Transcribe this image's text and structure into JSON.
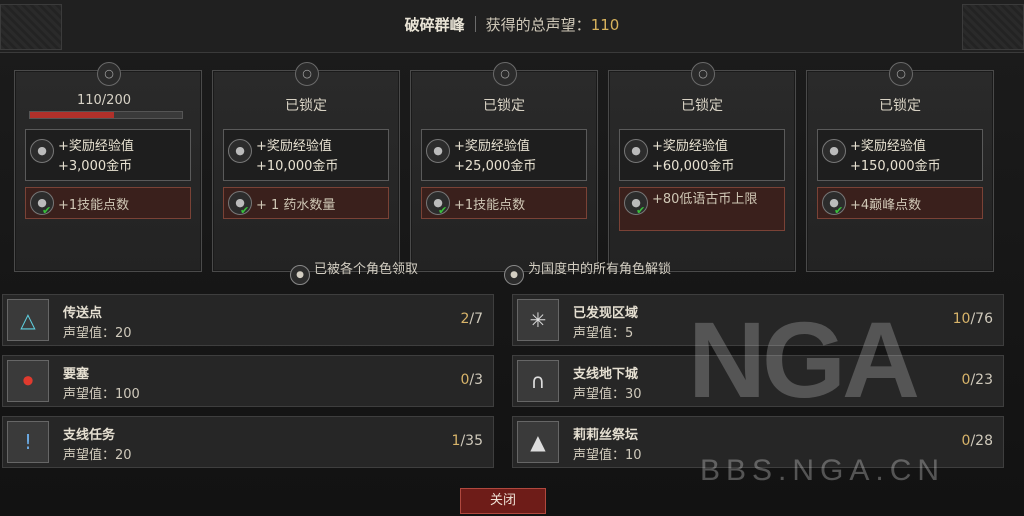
{
  "header": {
    "region_name": "破碎群峰",
    "renown_label": "获得的总声望：",
    "renown_total": "110"
  },
  "tiers": [
    {
      "status": "",
      "progress": "110/200",
      "progress_fraction": 0.55,
      "xp_label": "+奖励经验值",
      "gold_label": "+3,000金币",
      "bonus_label": "+1技能点数",
      "bonus_tall": false
    },
    {
      "status": "已锁定",
      "progress": "",
      "progress_fraction": null,
      "xp_label": "+奖励经验值",
      "gold_label": "+10,000金币",
      "bonus_label": "+ 1 药水数量",
      "bonus_tall": false
    },
    {
      "status": "已锁定",
      "progress": "",
      "progress_fraction": null,
      "xp_label": "+奖励经验值",
      "gold_label": "+25,000金币",
      "bonus_label": "+1技能点数",
      "bonus_tall": false
    },
    {
      "status": "已锁定",
      "progress": "",
      "progress_fraction": null,
      "xp_label": "+奖励经验值",
      "gold_label": "+60,000金币",
      "bonus_label": "+80低语古币上限",
      "bonus_tall": true
    },
    {
      "status": "已锁定",
      "progress": "",
      "progress_fraction": null,
      "xp_label": "+奖励经验值",
      "gold_label": "+150,000金币",
      "bonus_label": "+4巅峰点数",
      "bonus_tall": false
    }
  ],
  "legend": {
    "claimed_label": "已被各个角色领取",
    "realm_label": "为国度中的所有角色解锁"
  },
  "categories": [
    {
      "name": "传送点",
      "rep_label": "声望值：",
      "rep_value": "20",
      "current": "2",
      "total": "/7",
      "icon": "waypoint-icon"
    },
    {
      "name": "要塞",
      "rep_label": "声望值：",
      "rep_value": "100",
      "current": "0",
      "total": "/3",
      "icon": "stronghold-icon"
    },
    {
      "name": "支线任务",
      "rep_label": "声望值：",
      "rep_value": "20",
      "current": "1",
      "total": "/35",
      "icon": "side-quest-icon"
    },
    {
      "name": "已发现区域",
      "rep_label": "声望值：",
      "rep_value": "5",
      "current": "10",
      "total": "/76",
      "icon": "compass-icon"
    },
    {
      "name": "支线地下城",
      "rep_label": "声望值：",
      "rep_value": "30",
      "current": "0",
      "total": "/23",
      "icon": "dungeon-gate-icon"
    },
    {
      "name": "莉莉丝祭坛",
      "rep_label": "声望值：",
      "rep_value": "10",
      "current": "0",
      "total": "/28",
      "icon": "lilith-altar-icon"
    }
  ],
  "close_label": "关闭",
  "watermark": {
    "logo": "NGA",
    "url": "BBS.NGA.CN"
  }
}
